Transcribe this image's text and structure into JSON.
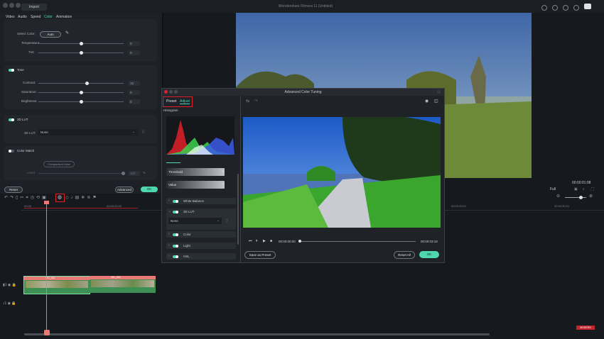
{
  "app": {
    "title": "Wondershare Filmora 11 (Untitled)",
    "import_tab": "Import"
  },
  "colors": {
    "accent": "#4fd6b0",
    "highlight": "#e0202a",
    "clip": "#3e8f54",
    "clip_header": "#e77a74"
  },
  "left_panel": {
    "tabs": [
      "Video",
      "Audio",
      "Speed",
      "Color",
      "Animation"
    ],
    "active_tab": "Color",
    "white_balance": {
      "select_color_label": "Select Color:",
      "auto_button": "Auto",
      "rows": [
        {
          "label": "Temperature:",
          "value": "0",
          "level": 0.5
        },
        {
          "label": "Tint:",
          "value": "0",
          "level": 0.5
        }
      ]
    },
    "tone": {
      "title": "Tone",
      "rows": [
        {
          "label": "Contrast:",
          "value": "12",
          "level": 0.56
        },
        {
          "label": "Saturation:",
          "value": "0",
          "level": 0.5
        },
        {
          "label": "Brightness:",
          "value": "0",
          "level": 0.5
        }
      ]
    },
    "lut": {
      "title": "3D LUT",
      "label": "3D LUT:",
      "value": "None"
    },
    "color_match": {
      "title": "Color Match",
      "comparison_button": "Comparison View",
      "level_label": "Level",
      "level_value": "100",
      "level_unit": "%"
    },
    "footer": {
      "reset": "Reset",
      "advanced": "Advanced",
      "ok": "OK"
    }
  },
  "preview_panel": {
    "timecode": "00:00:01:08",
    "quality": "Full"
  },
  "timeline": {
    "ruler": [
      "00:00",
      "00:00:05:00",
      "00:00:10:00",
      "00:00:15:00",
      "00:00:20:00",
      "00:00:25:01"
    ],
    "ruler_right": "00:00:30:01",
    "track_labels": [
      "1",
      "1"
    ],
    "clip_labels": [
      "VID_001",
      "VID_002"
    ],
    "badge": "MODERN"
  },
  "dialog": {
    "title": "Advanced Color Tuning",
    "tabs": [
      "Preset",
      "Adjust"
    ],
    "active_tab": "Adjust",
    "histogram_label": "Histogram",
    "threshold_label": "Threshold",
    "threshold_value": "0",
    "value_label": "Value",
    "value_value": "0",
    "sections": [
      "White Balance",
      "3D LUT",
      "Color",
      "Light",
      "HSL"
    ],
    "lut_value": "None",
    "time_current": "00:00:00:00",
    "time_total": "00:00:03:18",
    "save_preset": "Save as Preset",
    "reset_all": "Reset All",
    "ok": "OK"
  }
}
